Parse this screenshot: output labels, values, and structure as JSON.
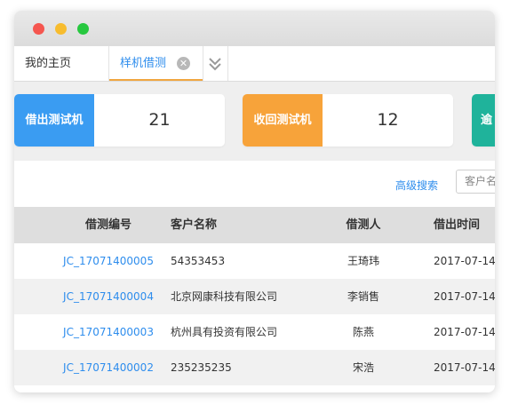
{
  "window": {
    "controls": [
      "close",
      "minimize",
      "maximize"
    ]
  },
  "tabs": [
    {
      "label": "我的主页",
      "active": false
    },
    {
      "label": "样机借测",
      "active": true,
      "close_icon": "close-icon"
    }
  ],
  "tab_overflow_icon": "double-chevron-down-icon",
  "stats": [
    {
      "label": "借出测试机",
      "value": "21",
      "color": "#3a9cf2"
    },
    {
      "label": "收回测试机",
      "value": "12",
      "color": "#f7a33a"
    },
    {
      "label": "逾",
      "value": "",
      "color": "#1fb39b"
    }
  ],
  "toolbar": {
    "advanced_search": "高级搜索",
    "search_placeholder": "客户名"
  },
  "table": {
    "columns": [
      "借测编号",
      "客户名称",
      "借测人",
      "借出时间"
    ],
    "rows": [
      [
        "JC_17071400005",
        "54353453",
        "王琦玮",
        "2017-07-14"
      ],
      [
        "JC_17071400004",
        "北京网康科技有限公司",
        "李销售",
        "2017-07-14"
      ],
      [
        "JC_17071400003",
        "杭州具有投资有限公司",
        "陈燕",
        "2017-07-14"
      ],
      [
        "JC_17071400002",
        "235235235",
        "宋浩",
        "2017-07-14"
      ]
    ]
  }
}
